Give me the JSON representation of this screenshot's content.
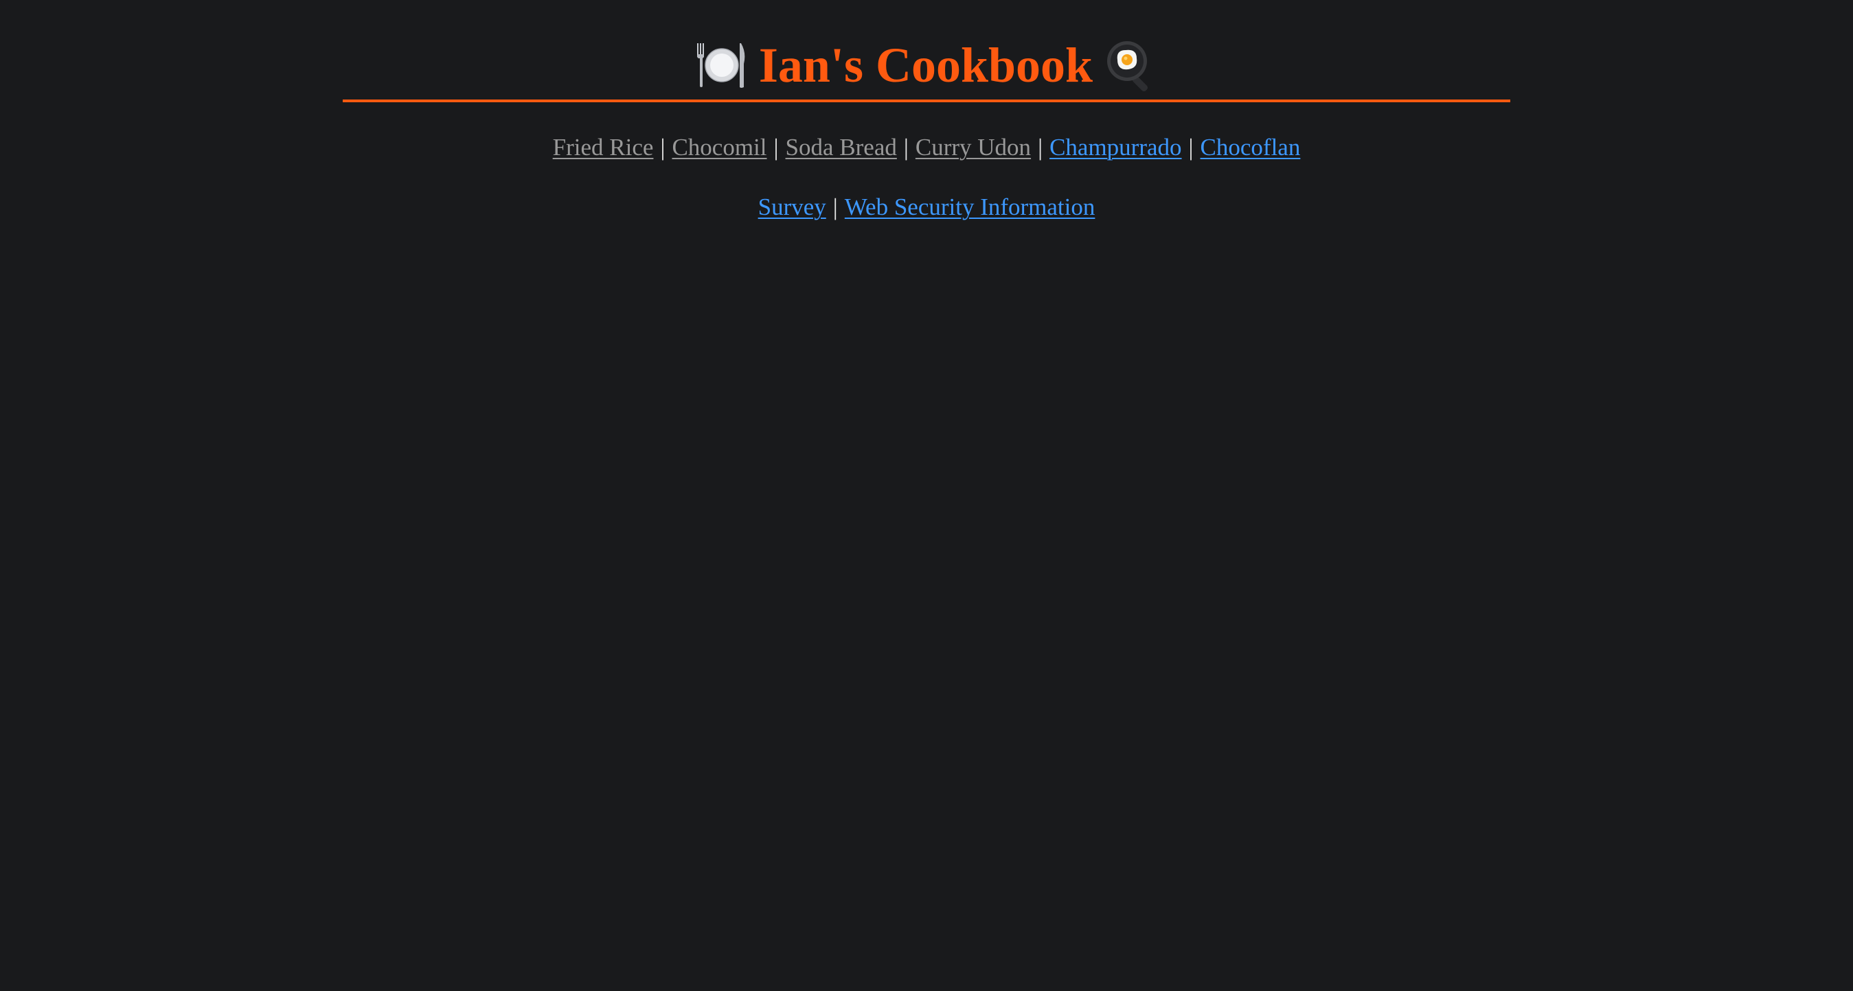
{
  "header": {
    "title": "Ian's Cookbook",
    "left_icon": "plate-with-cutlery-icon",
    "right_icon": "frying-pan-egg-icon",
    "accent_color": "#ff5a10"
  },
  "recipe_nav": {
    "separator": "|",
    "items": [
      {
        "label": "Fried Rice",
        "state": "visited"
      },
      {
        "label": "Chocomil",
        "state": "visited"
      },
      {
        "label": "Soda Bread",
        "state": "visited"
      },
      {
        "label": "Curry Udon",
        "state": "visited"
      },
      {
        "label": "Champurrado",
        "state": "unvisited"
      },
      {
        "label": "Chocoflan",
        "state": "unvisited"
      }
    ]
  },
  "extra_nav": {
    "separator": "|",
    "items": [
      {
        "label": "Survey",
        "state": "unvisited"
      },
      {
        "label": "Web Security Information",
        "state": "unvisited"
      }
    ]
  },
  "colors": {
    "background": "#191a1c",
    "visited_link": "#999999",
    "unvisited_link": "#3d98ff",
    "separator": "#e8e8e8"
  }
}
